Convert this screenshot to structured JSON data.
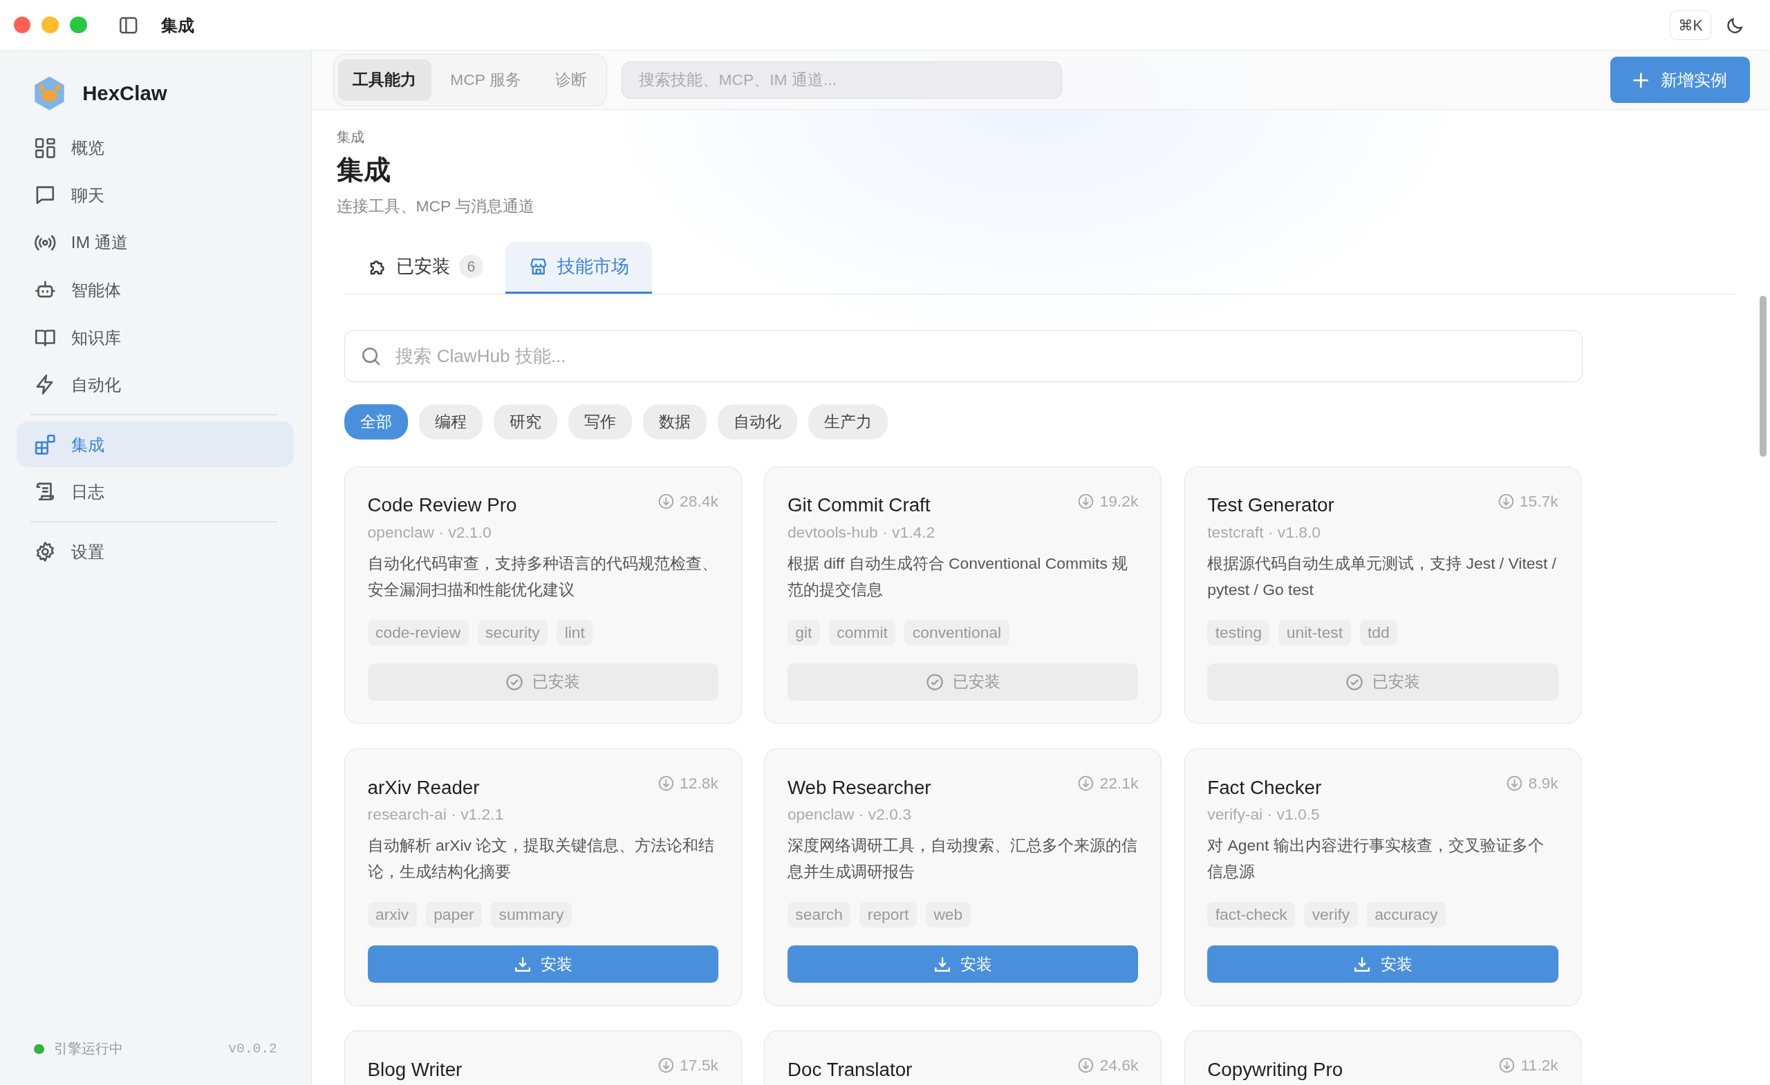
{
  "window": {
    "title": "集成",
    "shortcut": "⌘K"
  },
  "sidebar": {
    "app_name": "HexClaw",
    "nav_groups": [
      [
        {
          "label": "概览",
          "selected": false
        },
        {
          "label": "聊天",
          "selected": false
        },
        {
          "label": "IM 通道",
          "selected": false
        },
        {
          "label": "智能体",
          "selected": false
        },
        {
          "label": "知识库",
          "selected": false
        },
        {
          "label": "自动化",
          "selected": false
        }
      ],
      [
        {
          "label": "集成",
          "selected": true
        },
        {
          "label": "日志",
          "selected": false
        }
      ],
      [
        {
          "label": "设置",
          "selected": false
        }
      ]
    ],
    "status": {
      "text": "引擎运行中",
      "running": true,
      "version": "v0.0.2"
    }
  },
  "toolbar": {
    "segments": [
      {
        "label": "工具能力",
        "selected": true
      },
      {
        "label": "MCP 服务",
        "selected": false
      },
      {
        "label": "诊断",
        "selected": false
      }
    ],
    "search": {
      "placeholder": "搜索技能、MCP、IM 通道..."
    },
    "add_button": "新增实例"
  },
  "page": {
    "breadcrumb": "集成",
    "title": "集成",
    "subtitle": "连接工具、MCP 与消息通道"
  },
  "tabs": [
    {
      "label": "已安装",
      "count": "6",
      "selected": false
    },
    {
      "label": "技能市场",
      "selected": true
    }
  ],
  "market_search": {
    "placeholder": "搜索 ClawHub 技能..."
  },
  "filters": [
    {
      "label": "全部",
      "selected": true
    },
    {
      "label": "编程",
      "selected": false
    },
    {
      "label": "研究",
      "selected": false
    },
    {
      "label": "写作",
      "selected": false
    },
    {
      "label": "数据",
      "selected": false
    },
    {
      "label": "自动化",
      "selected": false
    },
    {
      "label": "生产力",
      "selected": false
    }
  ],
  "skills": [
    {
      "name": "Code Review Pro",
      "downloads": "28.4k",
      "meta": "openclaw · v2.1.0",
      "description": "自动化代码审查，支持多种语言的代码规范检查、安全漏洞扫描和性能优化建议",
      "tags": [
        "code-review",
        "security",
        "lint"
      ],
      "installed": true,
      "button": "已安装"
    },
    {
      "name": "Git Commit Craft",
      "downloads": "19.2k",
      "meta": "devtools-hub · v1.4.2",
      "description": "根据 diff 自动生成符合 Conventional Commits 规范的提交信息",
      "tags": [
        "git",
        "commit",
        "conventional"
      ],
      "installed": true,
      "button": "已安装"
    },
    {
      "name": "Test Generator",
      "downloads": "15.7k",
      "meta": "testcraft · v1.8.0",
      "description": "根据源代码自动生成单元测试，支持 Jest / Vitest / pytest / Go test",
      "tags": [
        "testing",
        "unit-test",
        "tdd"
      ],
      "installed": true,
      "button": "已安装"
    },
    {
      "name": "arXiv Reader",
      "downloads": "12.8k",
      "meta": "research-ai · v1.2.1",
      "description": "自动解析 arXiv 论文，提取关键信息、方法论和结论，生成结构化摘要",
      "tags": [
        "arxiv",
        "paper",
        "summary"
      ],
      "installed": false,
      "button": "安装"
    },
    {
      "name": "Web Researcher",
      "downloads": "22.1k",
      "meta": "openclaw · v2.0.3",
      "description": "深度网络调研工具，自动搜索、汇总多个来源的信息并生成调研报告",
      "tags": [
        "search",
        "report",
        "web"
      ],
      "installed": false,
      "button": "安装"
    },
    {
      "name": "Fact Checker",
      "downloads": "8.9k",
      "meta": "verify-ai · v1.0.5",
      "description": "对 Agent 输出内容进行事实核查，交叉验证多个信息源",
      "tags": [
        "fact-check",
        "verify",
        "accuracy"
      ],
      "installed": false,
      "button": "安装"
    },
    {
      "name": "Blog Writer",
      "downloads": "17.5k"
    },
    {
      "name": "Doc Translator",
      "downloads": "24.6k"
    },
    {
      "name": "Copywriting Pro",
      "downloads": "11.2k"
    }
  ]
}
